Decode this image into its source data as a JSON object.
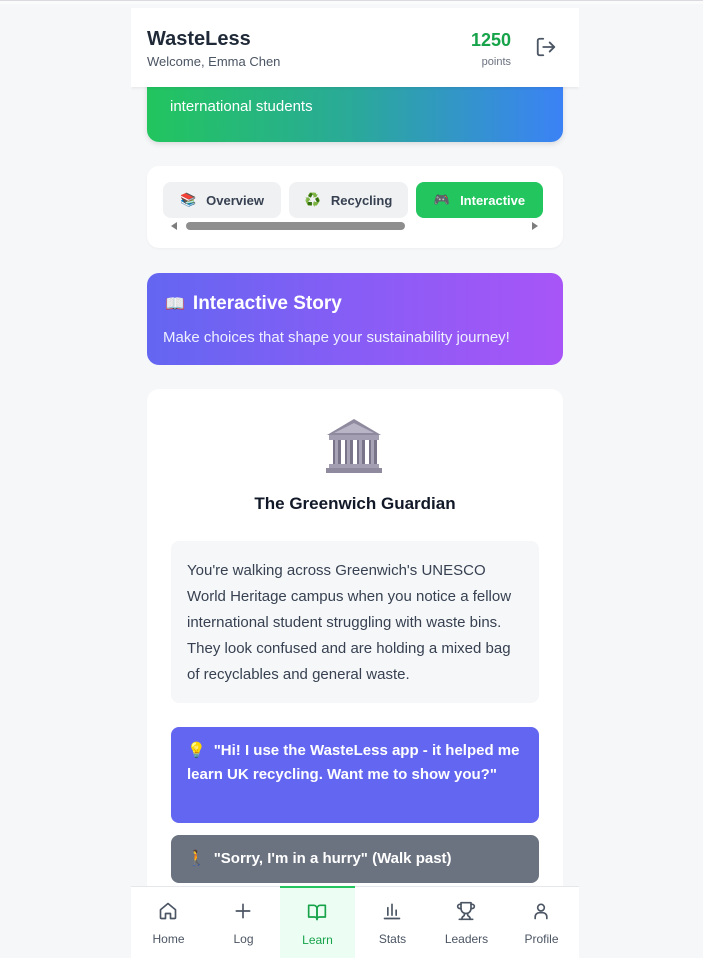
{
  "header": {
    "brand": "WasteLess",
    "welcome": "Welcome, Emma Chen",
    "points_value": "1250",
    "points_label": "points",
    "logout_icon": "logout-icon"
  },
  "hero": {
    "text": "international students"
  },
  "tabs": [
    {
      "label": "Overview",
      "icon": "📚",
      "active": false
    },
    {
      "label": "Recycling",
      "icon": "♻️",
      "active": false
    },
    {
      "label": "Interactive",
      "icon": "🎮",
      "active": true
    }
  ],
  "story_banner": {
    "icon": "📖",
    "title": "Interactive Story",
    "subtitle": "Make choices that shape your sustainability journey!"
  },
  "story": {
    "icon": "classical-building-icon",
    "title": "The Greenwich Guardian",
    "narrative": "You're walking across Greenwich's UNESCO World Heritage campus when you notice a fellow international student struggling with waste bins. They look confused and are holding a mixed bag of recyclables and general waste.",
    "choices": [
      {
        "icon": "💡",
        "text": "\"Hi! I use the WasteLess app - it helped me learn UK recycling. Want me to show you?\""
      },
      {
        "icon": "🚶",
        "text": "\"Sorry, I'm in a hurry\" (Walk past)"
      }
    ]
  },
  "bottom_nav": [
    {
      "label": "Home",
      "icon": "home-icon",
      "active": false
    },
    {
      "label": "Log",
      "icon": "plus-icon",
      "active": false
    },
    {
      "label": "Learn",
      "icon": "book-icon",
      "active": true
    },
    {
      "label": "Stats",
      "icon": "bar-chart-icon",
      "active": false
    },
    {
      "label": "Leaders",
      "icon": "trophy-icon",
      "active": false
    },
    {
      "label": "Profile",
      "icon": "user-icon",
      "active": false
    }
  ],
  "colors": {
    "accent_green": "#22c55e",
    "points_green": "#16a34a",
    "story_purple": "#6366f1",
    "choice_gray": "#6b7280"
  }
}
